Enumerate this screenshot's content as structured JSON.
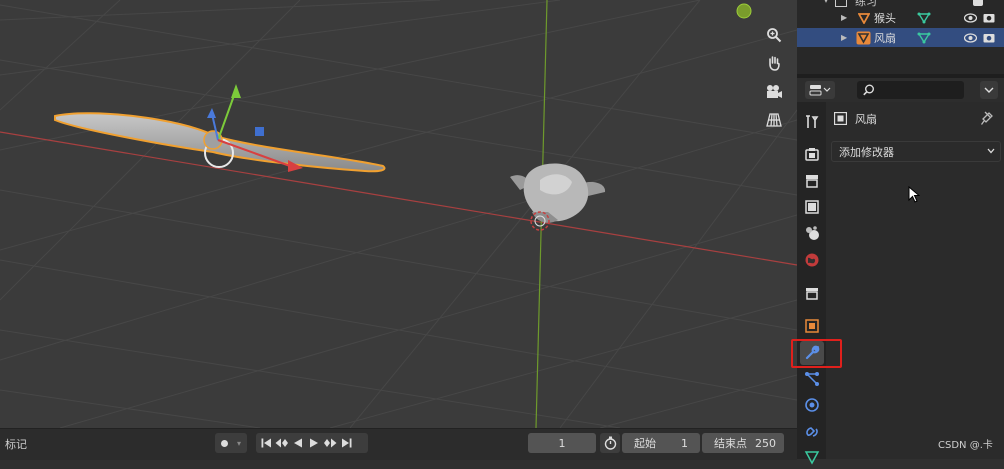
{
  "outliner": {
    "collection": "练习",
    "items": [
      {
        "name": "猴头",
        "selected": false
      },
      {
        "name": "风扇",
        "selected": true
      }
    ]
  },
  "properties": {
    "object_name": "风扇",
    "add_modifier_label": "添加修改器",
    "search_placeholder": ""
  },
  "timeline": {
    "markers_label": "标记",
    "current_frame": "1",
    "start_label": "起始",
    "start_value": "1",
    "end_label": "结束点",
    "end_value": "250"
  },
  "watermark": "CSDN @.卡",
  "colors": {
    "accent_selected": "#334d80",
    "x_axis": "#c84040",
    "y_axis": "#7fa630",
    "object_outline": "#f0a030",
    "highlight": "#e0201c"
  },
  "icons": {
    "viewport_nav": [
      "zoom-icon",
      "hand-pan-icon",
      "camera-icon",
      "grid-perspective-icon"
    ],
    "property_tabs": [
      "tool-icon",
      "render-icon",
      "output-icon",
      "view-layer-icon",
      "scene-icon",
      "world-icon",
      "collection-icon",
      "object-icon",
      "modifier-wrench-icon",
      "particles-icon",
      "physics-icon",
      "constraints-icon",
      "data-icon"
    ]
  }
}
